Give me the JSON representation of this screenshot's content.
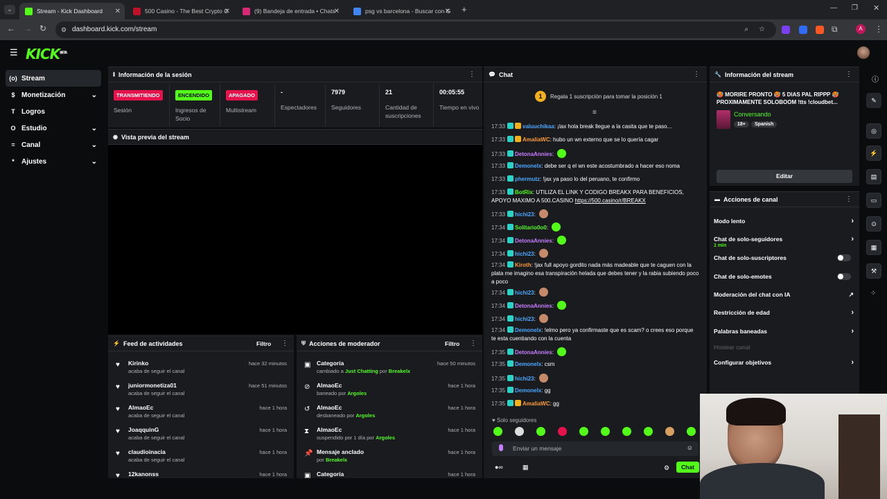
{
  "browser": {
    "tabs": [
      {
        "title": "Stream - Kick Dashboard",
        "color": "#53fc18"
      },
      {
        "title": "500 Casino - The Best Crypto C",
        "color": "#c0102a"
      },
      {
        "title": "(9) Bandeja de entrada • Chats",
        "color": "#d62976"
      },
      {
        "title": "psg vs barcelona - Buscar con G",
        "color": "#4285f4"
      }
    ],
    "url": "dashboard.kick.com/stream"
  },
  "nav": {
    "logo": "KICK",
    "logo_suffix": "BETA"
  },
  "sidebar": {
    "items": [
      {
        "label": "Stream",
        "icon": "(o)"
      },
      {
        "label": "Monetización",
        "icon": "$"
      },
      {
        "label": "Logros",
        "icon": "T"
      },
      {
        "label": "Estudio",
        "icon": "O"
      },
      {
        "label": "Canal",
        "icon": "="
      },
      {
        "label": "Ajustes",
        "icon": "*"
      }
    ]
  },
  "session": {
    "title": "Información de la sesión",
    "stats": [
      {
        "badge": "TRANSMITIENDO",
        "label": "Sesión"
      },
      {
        "badge": "ENCENDIDO",
        "label": "Ingresos de Socio"
      },
      {
        "badge": "APAGADO",
        "label": "Multistream"
      },
      {
        "value": "-",
        "label": "Espectadores"
      },
      {
        "value": "7979",
        "label": "Seguidores"
      },
      {
        "value": "21",
        "label": "Cantidad de suscripciones"
      },
      {
        "value": "00:05:55",
        "label": "Tiempo en vivo"
      }
    ]
  },
  "preview": {
    "title": "Vista previa del stream"
  },
  "feed": {
    "title": "Feed de actividades",
    "filter": "Filtro",
    "rows": [
      {
        "name": "Kirinko",
        "sub": "acaba de seguir el canal",
        "time": "hace 32 minutos"
      },
      {
        "name": "juniormonetiza01",
        "sub": "acaba de seguir el canal",
        "time": "hace 51 minutos"
      },
      {
        "name": "AlmaoEc",
        "sub": "acaba de seguir el canal",
        "time": "hace 1 hora"
      },
      {
        "name": "JoaqquinG",
        "sub": "acaba de seguir el canal",
        "time": "hace 1 hora"
      },
      {
        "name": "claudioinacia",
        "sub": "acaba de seguir el canal",
        "time": "hace 1 hora"
      },
      {
        "name": "12kanonss",
        "sub": "",
        "time": "hace 1 hora"
      }
    ]
  },
  "mod": {
    "title": "Acciones de moderador",
    "filter": "Filtro",
    "rows": [
      {
        "name": "Categoría",
        "pre": "cambiado a ",
        "hl": "Just Chatting",
        "mid": " por ",
        "by": "Breakelx",
        "time": "hace 50 minutos"
      },
      {
        "name": "AlmaoEc",
        "pre": "baneado por ",
        "hl": "",
        "mid": "",
        "by": "Argoles",
        "time": "hace 1 hora"
      },
      {
        "name": "AlmaoEc",
        "pre": "desbaneado por ",
        "hl": "",
        "mid": "",
        "by": "Argoles",
        "time": "hace 1 hora"
      },
      {
        "name": "AlmaoEc",
        "pre": "suspendido por 1 día por ",
        "hl": "",
        "mid": "",
        "by": "Argoles",
        "time": "hace 1 hora"
      },
      {
        "name": "Mensaje anclado",
        "pre": "por ",
        "hl": "",
        "mid": "",
        "by": "Breakelx",
        "time": "hace 1 hora"
      },
      {
        "name": "Categoría",
        "pre": "",
        "hl": "",
        "mid": "",
        "by": "",
        "time": "hace 1 hora"
      }
    ]
  },
  "chat": {
    "title": "Chat",
    "gift_text": "Regala 1 suscripción para tomar la posición 1",
    "gift_rank": "1",
    "messages": [
      {
        "time": "17:33",
        "user": "valuuchikaa",
        "color": "#4aa8ff",
        "text": "¡lax hola break llegue a la casita que te paso..."
      },
      {
        "time": "17:33",
        "user": "AmaliaWC",
        "color": "#ff9b2e",
        "text": "hubo un wn externo que se lo quería cagar"
      },
      {
        "time": "17:33",
        "user": "DetonaAnnies",
        "color": "#c77dff",
        "text": ""
      },
      {
        "time": "17:33",
        "user": "Demonelx",
        "color": "#4aa8ff",
        "text": "debe ser q el wn este acostumbrado a hacer eso noma"
      },
      {
        "time": "17:33",
        "user": "phermutz",
        "color": "#4aa8ff",
        "text": "!jax ya paso lo del peruano, te confirmo"
      },
      {
        "time": "17:33",
        "user": "BotRix",
        "color": "#53fc18",
        "text": "UTILIZA EL LINK Y CODIGO BREAKX PARA BENEFICIOS, APOYO MAXIMO A 500.CASINO ",
        "link": "https://500.casino/r/BREAKX"
      },
      {
        "time": "17:33",
        "user": "hichi23",
        "color": "#4aa8ff",
        "text": ""
      },
      {
        "time": "17:34",
        "user": "Solitario0o0",
        "color": "#53fc18",
        "text": ""
      },
      {
        "time": "17:34",
        "user": "DetonaAnnies",
        "color": "#c77dff",
        "text": ""
      },
      {
        "time": "17:34",
        "user": "hichi23",
        "color": "#4aa8ff",
        "text": ""
      },
      {
        "time": "17:34",
        "user": "Kiroth",
        "color": "#ff9b2e",
        "text": "!jax full apoyo gordito nada más madeable que te caguen con la plata me imagino esa transpiración helada que debes tener y la rabia subiendo poco a poco"
      },
      {
        "time": "17:34",
        "user": "hichi23",
        "color": "#4aa8ff",
        "text": ""
      },
      {
        "time": "17:34",
        "user": "DetonaAnnies",
        "color": "#c77dff",
        "text": ""
      },
      {
        "time": "17:34",
        "user": "hichi23",
        "color": "#4aa8ff",
        "text": ""
      },
      {
        "time": "17:34",
        "user": "Demonelx",
        "color": "#4aa8ff",
        "text": "!elmo pero ya confirmaste que es scam? o crees eso porque te esta cuentiando con la cuenta"
      },
      {
        "time": "17:35",
        "user": "DetonaAnnies",
        "color": "#c77dff",
        "text": ""
      },
      {
        "time": "17:35",
        "user": "Demonelx",
        "color": "#4aa8ff",
        "text": "csm"
      },
      {
        "time": "17:35",
        "user": "hichi23",
        "color": "#4aa8ff",
        "text": ""
      },
      {
        "time": "17:35",
        "user": "Demonelx",
        "color": "#4aa8ff",
        "text": "gg"
      },
      {
        "time": "17:35",
        "user": "AmaliaWC",
        "color": "#ff9b2e",
        "text": "gg"
      }
    ],
    "followers_only": "Solo seguidores",
    "input_placeholder": "Enviar un mensaje",
    "send_label": "Chat"
  },
  "stream_info": {
    "title": "Información del stream",
    "stream_title": "🥵 MORIRE PRONTO 🥵 5 DIAS PAL RIPPP 🥵 PROXIMAMENTE SOLOBOOM !tts !cloudbet...",
    "category": "Conversando",
    "tags": [
      "18+",
      "Spanish"
    ],
    "edit_label": "Editar"
  },
  "channel_actions": {
    "title": "Acciones de canal",
    "items": [
      {
        "label": "Modo lento",
        "sub": "",
        "type": "arrow"
      },
      {
        "label": "Chat de solo-seguidores",
        "sub": "1 min",
        "type": "arrow"
      },
      {
        "label": "Chat de solo-suscriptores",
        "sub": "",
        "type": "toggle"
      },
      {
        "label": "Chat de solo-emotes",
        "sub": "",
        "type": "toggle"
      },
      {
        "label": "Moderación del chat con IA",
        "sub": "",
        "type": "external"
      },
      {
        "label": "Restricción de edad",
        "sub": "",
        "type": "arrow"
      },
      {
        "label": "Palabras baneadas",
        "sub": "",
        "type": "arrow"
      },
      {
        "label": "Hostear canal",
        "sub": "",
        "type": "disabled"
      },
      {
        "label": "Configurar objetivos",
        "sub": "",
        "type": "arrow"
      }
    ]
  }
}
